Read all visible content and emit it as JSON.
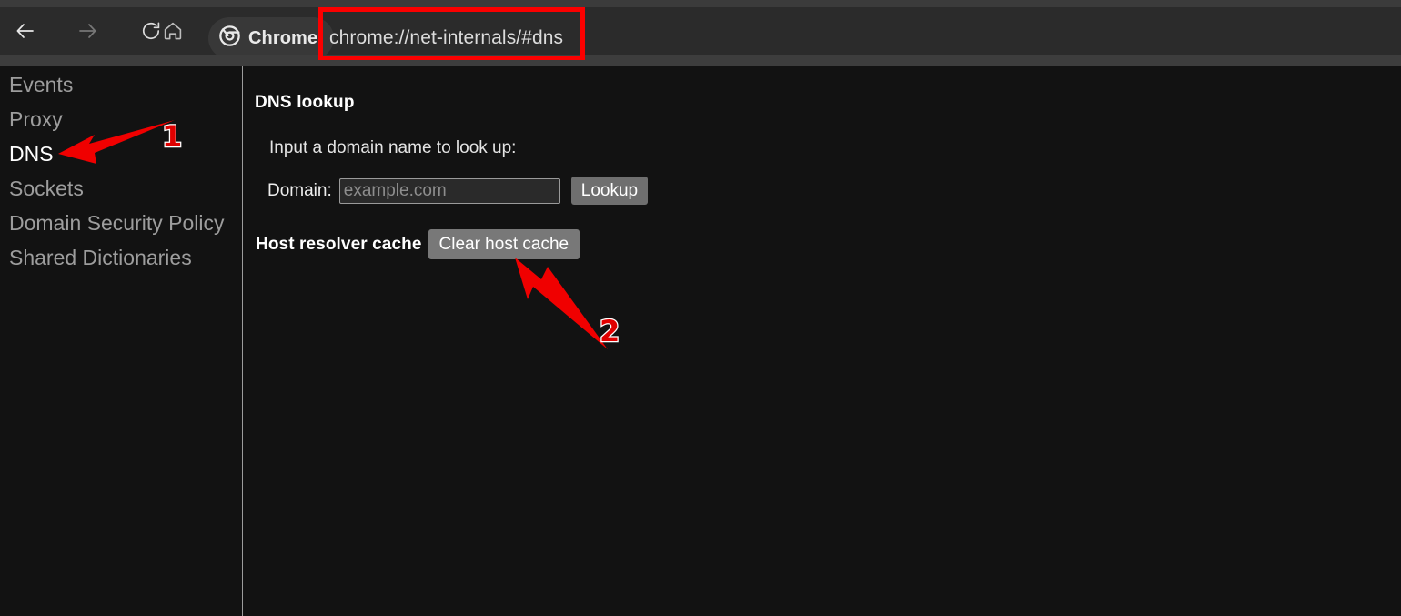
{
  "browser": {
    "toolbar": {
      "back_icon": "back-arrow-icon",
      "forward_icon": "forward-arrow-icon",
      "reload_icon": "reload-icon",
      "home_icon": "home-icon",
      "chrome_chip_label": "Chrome",
      "chrome_logo_icon": "chrome-logo-icon",
      "url": "chrome://net-internals/#dns"
    }
  },
  "sidebar": {
    "items": [
      {
        "label": "Events",
        "selected": false
      },
      {
        "label": "Proxy",
        "selected": false
      },
      {
        "label": "DNS",
        "selected": true
      },
      {
        "label": "Sockets",
        "selected": false
      },
      {
        "label": "Domain Security Policy",
        "selected": false
      },
      {
        "label": "Shared Dictionaries",
        "selected": false
      }
    ]
  },
  "main": {
    "heading": "DNS lookup",
    "lookup_prompt": "Input a domain name to look up:",
    "domain_label": "Domain:",
    "domain_value": "",
    "domain_placeholder": "example.com",
    "lookup_button": "Lookup",
    "cache_label": "Host resolver cache",
    "clear_cache_button": "Clear host cache"
  },
  "annotations": {
    "highlight_color": "#fb0000",
    "number_fill": "#e00000",
    "number_stroke": "#ffffff",
    "callouts": [
      {
        "label": "1",
        "target": "sidebar-item-dns"
      },
      {
        "label": "2",
        "target": "clear-host-cache-button"
      }
    ]
  }
}
